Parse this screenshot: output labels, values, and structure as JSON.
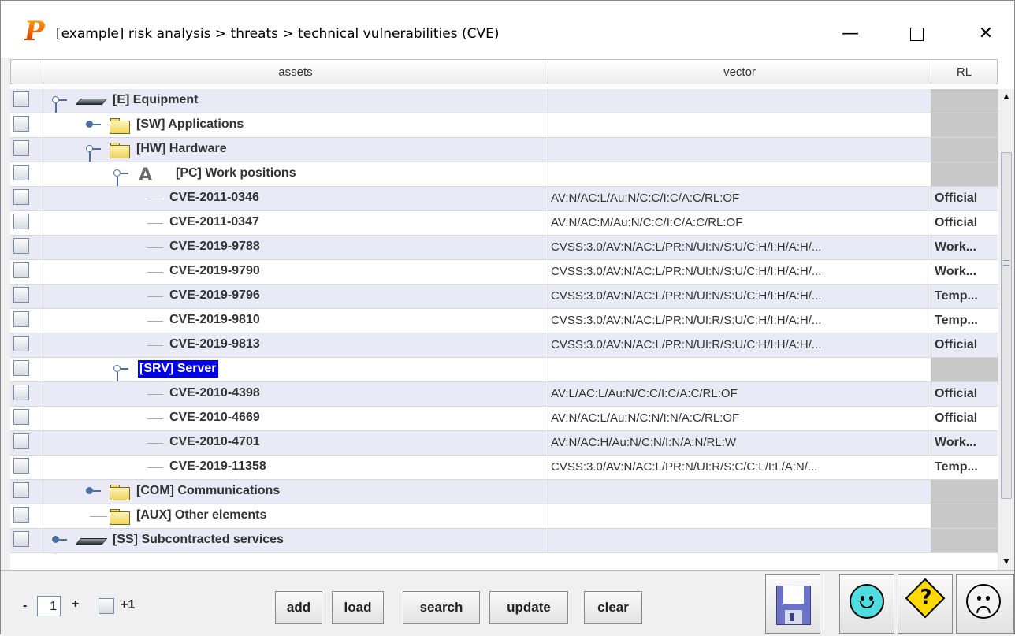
{
  "window": {
    "logo": "P",
    "title": "[example] risk analysis > threats > technical vulnerabilities (CVE)",
    "minimize": "—",
    "close": "✕"
  },
  "table": {
    "columns": {
      "assets": "assets",
      "vector": "vector",
      "rl": "RL"
    },
    "rows": [
      {
        "label": "[E] Equipment",
        "vector": "",
        "rl": ""
      },
      {
        "label": "[SW] Applications",
        "vector": "",
        "rl": ""
      },
      {
        "label": "[HW] Hardware",
        "vector": "",
        "rl": ""
      },
      {
        "label": "[PC] Work positions",
        "vector": "",
        "rl": ""
      },
      {
        "label": "CVE-2011-0346",
        "vector": "AV:N/AC:L/Au:N/C:C/I:C/A:C/RL:OF",
        "rl": "Official"
      },
      {
        "label": "CVE-2011-0347",
        "vector": "AV:N/AC:M/Au:N/C:C/I:C/A:C/RL:OF",
        "rl": "Official"
      },
      {
        "label": "CVE-2019-9788",
        "vector": "CVSS:3.0/AV:N/AC:L/PR:N/UI:N/S:U/C:H/I:H/A:H/...",
        "rl": "Work..."
      },
      {
        "label": "CVE-2019-9790",
        "vector": "CVSS:3.0/AV:N/AC:L/PR:N/UI:N/S:U/C:H/I:H/A:H/...",
        "rl": "Work..."
      },
      {
        "label": "CVE-2019-9796",
        "vector": "CVSS:3.0/AV:N/AC:L/PR:N/UI:N/S:U/C:H/I:H/A:H/...",
        "rl": "Temp..."
      },
      {
        "label": "CVE-2019-9810",
        "vector": "CVSS:3.0/AV:N/AC:L/PR:N/UI:R/S:U/C:H/I:H/A:H/...",
        "rl": "Temp..."
      },
      {
        "label": "CVE-2019-9813",
        "vector": "CVSS:3.0/AV:N/AC:L/PR:N/UI:R/S:U/C:H/I:H/A:H/...",
        "rl": "Official"
      },
      {
        "label": "[SRV] Server",
        "vector": "",
        "rl": ""
      },
      {
        "label": "CVE-2010-4398",
        "vector": "AV:L/AC:L/Au:N/C:C/I:C/A:C/RL:OF",
        "rl": "Official"
      },
      {
        "label": "CVE-2010-4669",
        "vector": "AV:N/AC:L/Au:N/C:N/I:N/A:C/RL:OF",
        "rl": "Official"
      },
      {
        "label": "CVE-2010-4701",
        "vector": "AV:N/AC:H/Au:N/C:N/I:N/A:N/RL:W",
        "rl": "Work..."
      },
      {
        "label": "CVE-2019-11358",
        "vector": "CVSS:3.0/AV:N/AC:L/PR:N/UI:R/S:C/C:L/I:L/A:N/...",
        "rl": "Temp..."
      },
      {
        "label": "[COM] Communications",
        "vector": "",
        "rl": ""
      },
      {
        "label": "[AUX] Other elements",
        "vector": "",
        "rl": ""
      },
      {
        "label": "[SS] Subcontracted services",
        "vector": "",
        "rl": ""
      }
    ]
  },
  "bottom": {
    "minus": "-",
    "level": "1",
    "plus": "+",
    "plus_one": "+1",
    "buttons": {
      "add": "add",
      "load": "load",
      "search": "search",
      "update": "update",
      "clear": "clear"
    }
  },
  "icons": {
    "save": "floppy-disk-icon",
    "ok": "smiley-happy-icon",
    "help": "question-diamond-icon",
    "cancel": "smiley-sad-icon"
  },
  "colors": {
    "selection": "#0000ee",
    "odd_row": "#e9eaf6",
    "rl_gray": "#c8c8c8",
    "happy_face": "#4fdde0",
    "warning": "#ffd900",
    "save_blue": "#6b73c7"
  }
}
